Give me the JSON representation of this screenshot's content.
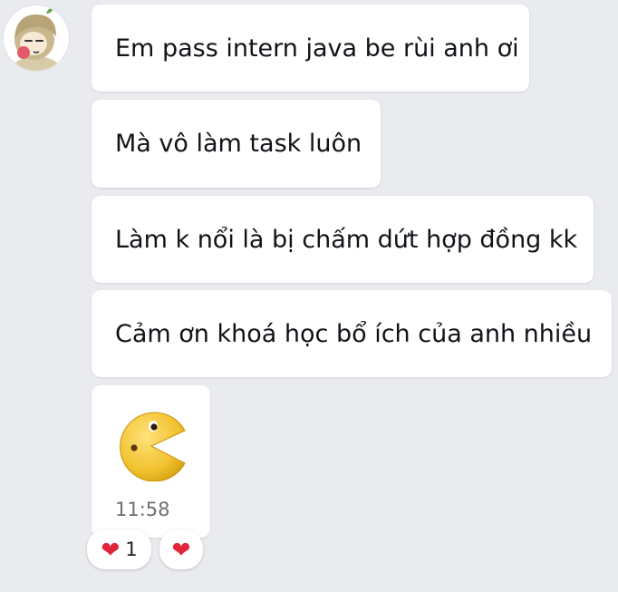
{
  "messages": [
    {
      "text": "Em pass intern java be rùi anh ơi"
    },
    {
      "text": "Mà vô làm task luôn"
    },
    {
      "text": "Làm k nổi là bị chấm dứt hợp đồng kk"
    },
    {
      "text": "Cảm ơn khoá học bổ ích của anh nhiều"
    }
  ],
  "sticker_message": {
    "sticker": "pacman-smiley-sticker",
    "time": "11:58"
  },
  "reactions": {
    "heart_icon": "heart-icon",
    "heart_count": "1",
    "add_heart_icon": "heart-icon"
  },
  "avatar": "cartoon-avatar",
  "colors": {
    "background": "#e9ebee",
    "bubble": "#ffffff",
    "heart": "#e0243a",
    "sticker_yellow": "#f2c230"
  }
}
